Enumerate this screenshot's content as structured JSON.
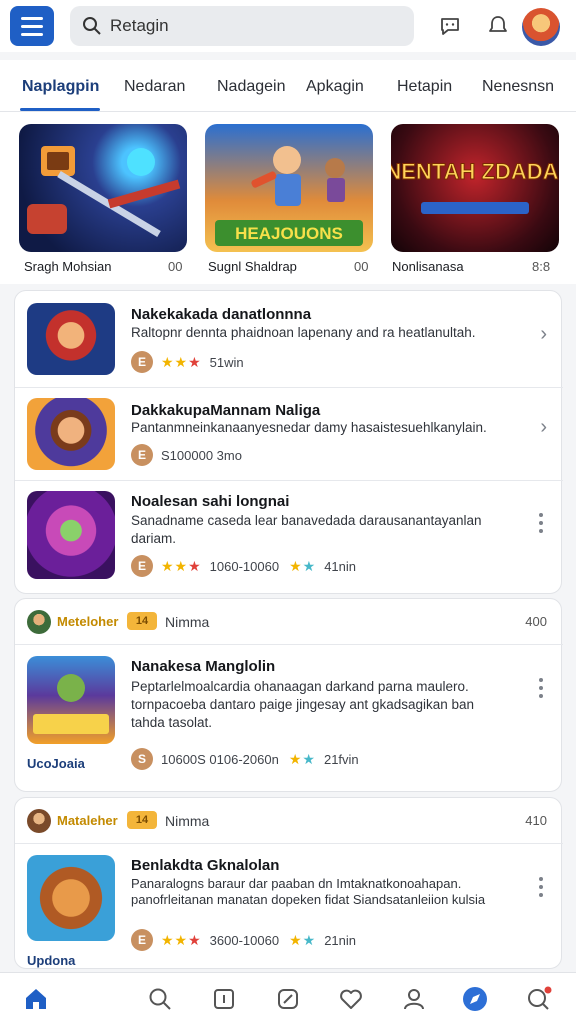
{
  "search": {
    "placeholder": "Retagin",
    "value": "Retagin"
  },
  "tabs": [
    "Naplagpin",
    "Nedaran",
    "Nadagein",
    "Apkagin",
    "Hetapin",
    "Nenesnsn"
  ],
  "featured": [
    {
      "caption": "Sragh Mohsian",
      "count": "00"
    },
    {
      "caption": "Sugnl Shaldrap",
      "count": "00",
      "banner": "HEAJOUONS"
    },
    {
      "caption": "Nonlisanasa",
      "count": "8:8",
      "banner": "SANENTAH ZDADAINS"
    }
  ],
  "list": [
    {
      "title": "Nakekakada danatlonnna",
      "desc": "Raltopnr dennta phaidnoan lapenany and ra heatlanultah.",
      "coin": "E",
      "stars": "★★★",
      "meta": "51win"
    },
    {
      "title": "DakkakupaMannam Naliga",
      "desc": "Pantanmneinkanaanyesnedar damy hasaistesuehlkanylain.",
      "coin": "E",
      "meta": "S100000 3mo"
    },
    {
      "title": "Noalesan sahi longnai",
      "desc": "Sanadname caseda lear banavedada darausanantayanlan dariam.",
      "coin": "E",
      "stars": "★★★",
      "meta": "1060-10060",
      "stars2": "★★",
      "meta2": "41nin"
    }
  ],
  "groups": [
    {
      "name": "Meteloher",
      "badge": "14",
      "label": "Nimma",
      "count": "400",
      "title": "Nanakesa Manglolin",
      "desc": "Peptarlelmoalcardia ohanaagan darkand parna maulero. tornpacoeba dantaro paige jingesay ant gkadsagikan ban tahda tasolat.",
      "sub": "UcoJoaia",
      "coin": "S",
      "meta": "10600S 0106-2060n",
      "stars2": "★★",
      "meta2": "21fvin"
    },
    {
      "name": "Mataleher",
      "badge": "14",
      "label": "Nimma",
      "count": "410",
      "title": "Benlakdta Gknalolan",
      "desc": "Panaralogns baraur dar paaban dn Imtaknatkonoahapan. panofrleitanan manatan dopeken fidat Siandsatanleiion kulsia",
      "sub": "Updona",
      "coin": "E",
      "stars": "★★★",
      "meta": "3600-10060",
      "stars2": "★★",
      "meta2": "21nin"
    }
  ],
  "colors": {
    "accent": "#1f5fc5",
    "star_gold": "#f2b400",
    "star_red": "#e0413a",
    "star_teal": "#47b8c9"
  }
}
